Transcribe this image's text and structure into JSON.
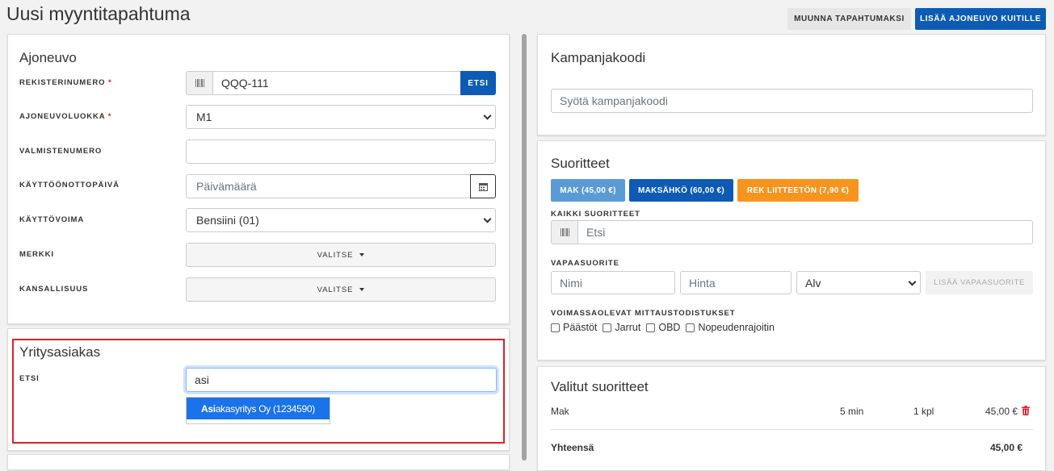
{
  "page": {
    "title": "Uusi myyntitapahtuma"
  },
  "toolbar": {
    "convert_label": "MUUNNA TAPAHTUMAKSI",
    "add_vehicle_label": "LISÄÄ AJONEUVO KUITILLE"
  },
  "vehicle": {
    "title": "Ajoneuvo",
    "reg_label": "REKISTERINUMERO",
    "reg_value": "QQQ-111",
    "search_btn": "ETSI",
    "class_label": "AJONEUVOLUOKKA",
    "class_value": "M1",
    "vin_label": "VALMISTENUMERO",
    "vin_value": "",
    "date_label": "KÄYTTÖÖNOTTOPÄIVÄ",
    "date_placeholder": "Päivämäärä",
    "fuel_label": "KÄYTTÖVOIMA",
    "fuel_value": "Bensiini (01)",
    "brand_label": "MERKKI",
    "brand_btn": "VALITSE",
    "nation_label": "KANSALLISUUS",
    "nation_btn": "VALITSE",
    "required_mark": "*"
  },
  "company": {
    "title": "Yritysasiakas",
    "search_label": "ETSI",
    "search_value": "asi",
    "suggestion_match": "Asi",
    "suggestion_rest": "akasyritys Oy (1234590)"
  },
  "campaign": {
    "title": "Kampanjakoodi",
    "placeholder": "Syötä kampanjakoodi"
  },
  "services": {
    "title": "Suoritteet",
    "chips": [
      {
        "label": "MAK (45,00 €)",
        "color": "#5b9bd5"
      },
      {
        "label": "MAKSÄHKÖ (60,00 €)",
        "color": "#0d5bb5"
      },
      {
        "label": "REK LIITTEETÖN (7,90 €)",
        "color": "#f7941d"
      }
    ],
    "all_label": "KAIKKI SUORITTEET",
    "all_placeholder": "Etsi",
    "free_label": "VAPAASUORITE",
    "name_placeholder": "Nimi",
    "price_placeholder": "Hinta",
    "vat_value": "Alv",
    "add_free_btn": "LISÄÄ VAPAASUORITE",
    "certs_label": "VOIMASSAOLEVAT MITTAUSTODISTUKSET",
    "certs": [
      "Päästöt",
      "Jarrut",
      "OBD",
      "Nopeudenrajoitin"
    ]
  },
  "selected": {
    "title": "Valitut suoritteet",
    "rows": [
      {
        "name": "Mak",
        "duration": "5 min",
        "qty": "1 kpl",
        "price": "45,00 €"
      }
    ],
    "total_label": "Yhteensä",
    "total_value": "45,00 €"
  },
  "colors": {
    "primary": "#0d5bb5",
    "highlight_border": "#d9232d",
    "suggestion_bg": "#1a73e8",
    "delete": "#d9232d"
  }
}
